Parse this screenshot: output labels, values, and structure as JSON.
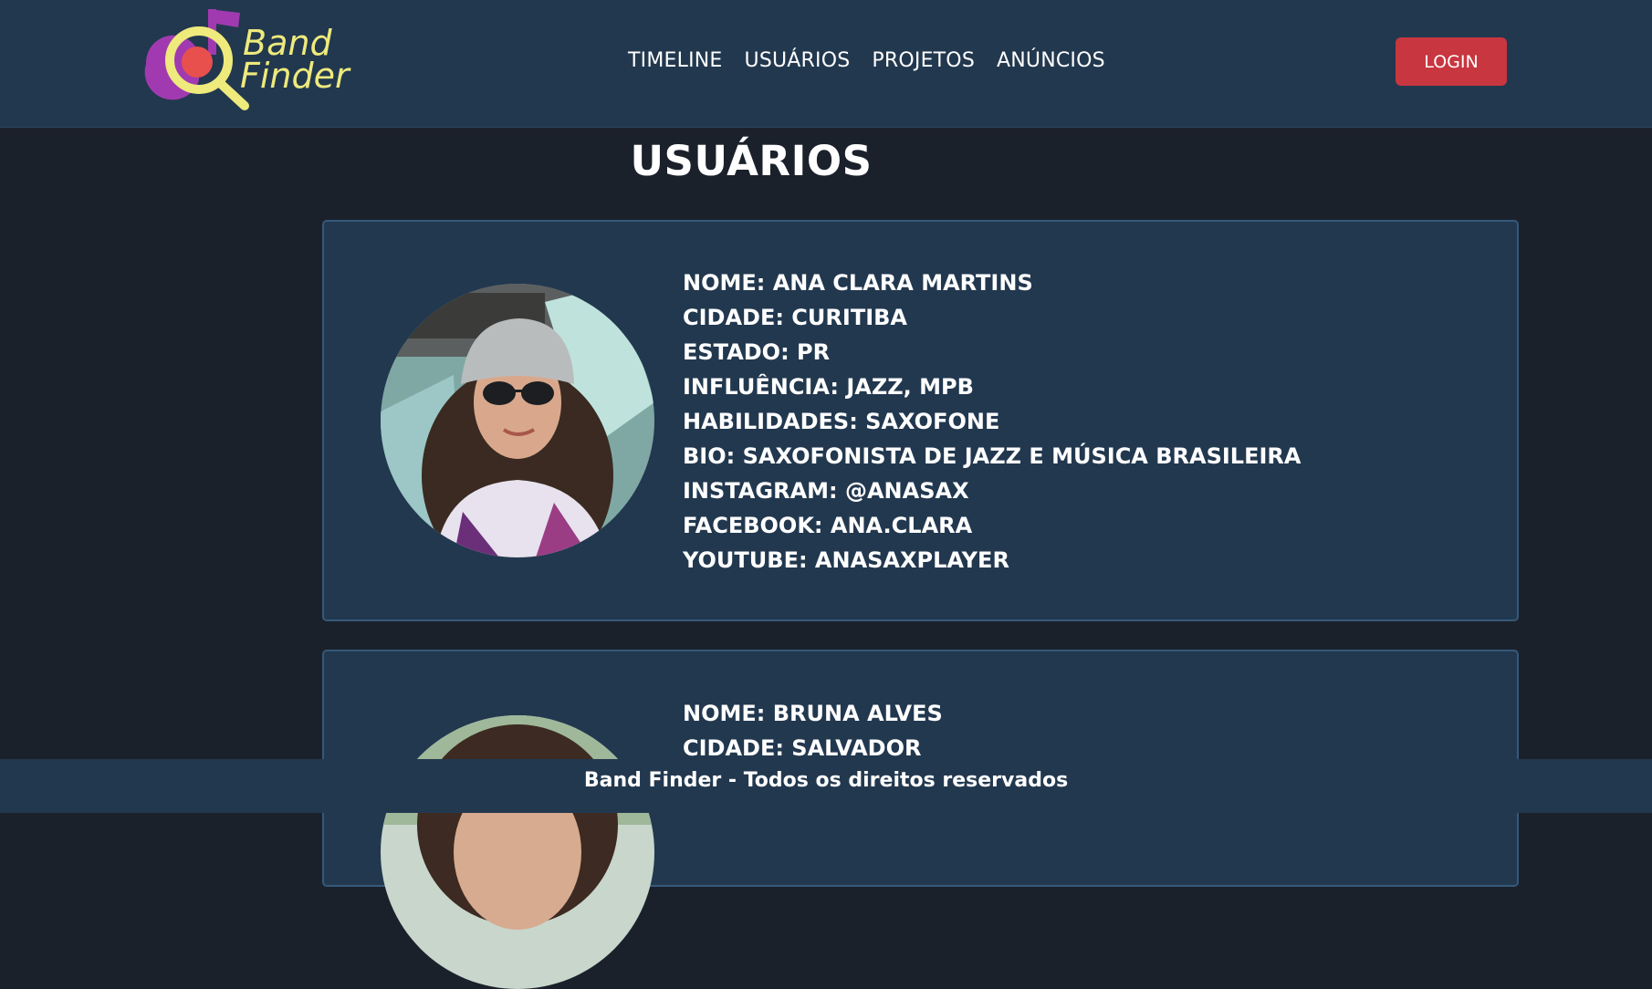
{
  "header": {
    "logo_text_line1": "Band",
    "logo_text_line2": "Finder",
    "nav": [
      {
        "label": "TIMELINE"
      },
      {
        "label": "USUÁRIOS"
      },
      {
        "label": "PROJETOS"
      },
      {
        "label": "ANÚNCIOS"
      }
    ],
    "login_label": "LOGIN"
  },
  "page": {
    "title": "USUÁRIOS"
  },
  "users": [
    {
      "nome": "NOME: ANA CLARA MARTINS",
      "cidade": "CIDADE: CURITIBA",
      "estado": "ESTADO: PR",
      "influencia": "INFLUÊNCIA: JAZZ, MPB",
      "habilidades": "HABILIDADES: SAXOFONE",
      "bio": "BIO: SAXOFONISTA DE JAZZ E MÚSICA BRASILEIRA",
      "instagram": "INSTAGRAM: @ANASAX",
      "facebook": "FACEBOOK: ANA.CLARA",
      "youtube": "YOUTUBE: ANASAXPLAYER"
    },
    {
      "nome": "NOME: BRUNA ALVES",
      "cidade": "CIDADE: SALVADOR"
    }
  ],
  "footer": {
    "text": "Band Finder - Todos os direitos reservados"
  },
  "colors": {
    "background": "#1b212b",
    "header": "#22384f",
    "card": "#22384f",
    "card_border": "#35597a",
    "login_button": "#c8363f",
    "logo_purple": "#a13ab0",
    "logo_red": "#e8504d",
    "logo_yellow": "#eeea7c"
  }
}
